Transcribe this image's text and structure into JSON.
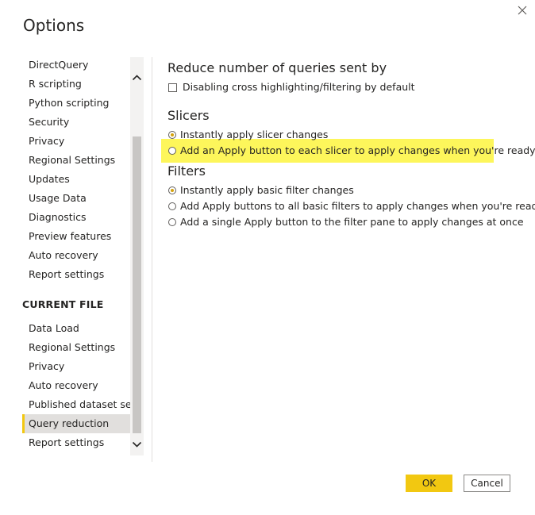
{
  "dialog": {
    "title": "Options"
  },
  "nav": {
    "global_items": [
      "DirectQuery",
      "R scripting",
      "Python scripting",
      "Security",
      "Privacy",
      "Regional Settings",
      "Updates",
      "Usage Data",
      "Diagnostics",
      "Preview features",
      "Auto recovery",
      "Report settings"
    ],
    "current_file_header": "CURRENT FILE",
    "current_file_items": [
      "Data Load",
      "Regional Settings",
      "Privacy",
      "Auto recovery",
      "Published dataset set...",
      "Query reduction",
      "Report settings"
    ],
    "active_item": "Query reduction"
  },
  "content": {
    "reduce_title": "Reduce number of queries sent by",
    "reduce_checkbox_label": "Disabling cross highlighting/filtering by default",
    "reduce_checkbox_checked": false,
    "slicers_title": "Slicers",
    "slicers_options": [
      "Instantly apply slicer changes",
      "Add an Apply button to each slicer to apply changes when you're ready"
    ],
    "slicers_selected": 0,
    "filters_title": "Filters",
    "filters_options": [
      "Instantly apply basic filter changes",
      "Add Apply buttons to all basic filters to apply changes when you're ready",
      "Add a single Apply button to the filter pane to apply changes at once"
    ],
    "filters_selected": 0
  },
  "buttons": {
    "ok": "OK",
    "cancel": "Cancel"
  },
  "colors": {
    "accent": "#f2c811",
    "highlight": "#fdf65b",
    "selected_nav_bg": "#e1dfdd"
  },
  "icons": {
    "close": "close-icon",
    "scroll_up": "chevron-up-icon",
    "scroll_down": "chevron-down-icon"
  }
}
